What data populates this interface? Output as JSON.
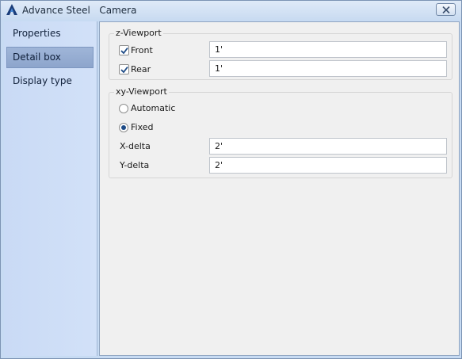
{
  "window": {
    "title": "Advance Steel   Camera",
    "icon": "advance-steel-logo-icon",
    "close_icon": "close-icon"
  },
  "sidebar": {
    "items": [
      {
        "label": "Properties",
        "active": false
      },
      {
        "label": "Detail box",
        "active": true
      },
      {
        "label": "Display type",
        "active": false
      }
    ]
  },
  "z_viewport": {
    "legend": "z-Viewport",
    "front": {
      "label": "Front",
      "checked": true,
      "value": "1'"
    },
    "rear": {
      "label": "Rear",
      "checked": true,
      "value": "1'"
    }
  },
  "xy_viewport": {
    "legend": "xy-Viewport",
    "automatic": {
      "label": "Automatic",
      "selected": false
    },
    "fixed": {
      "label": "Fixed",
      "selected": true
    },
    "x_delta": {
      "label": "X-delta",
      "value": "2'"
    },
    "y_delta": {
      "label": "Y-delta",
      "value": "2'"
    }
  },
  "colors": {
    "accent": "#1c4a86",
    "sidebar_bg": "#c9daf5",
    "active_item": "#9fb5d8"
  }
}
